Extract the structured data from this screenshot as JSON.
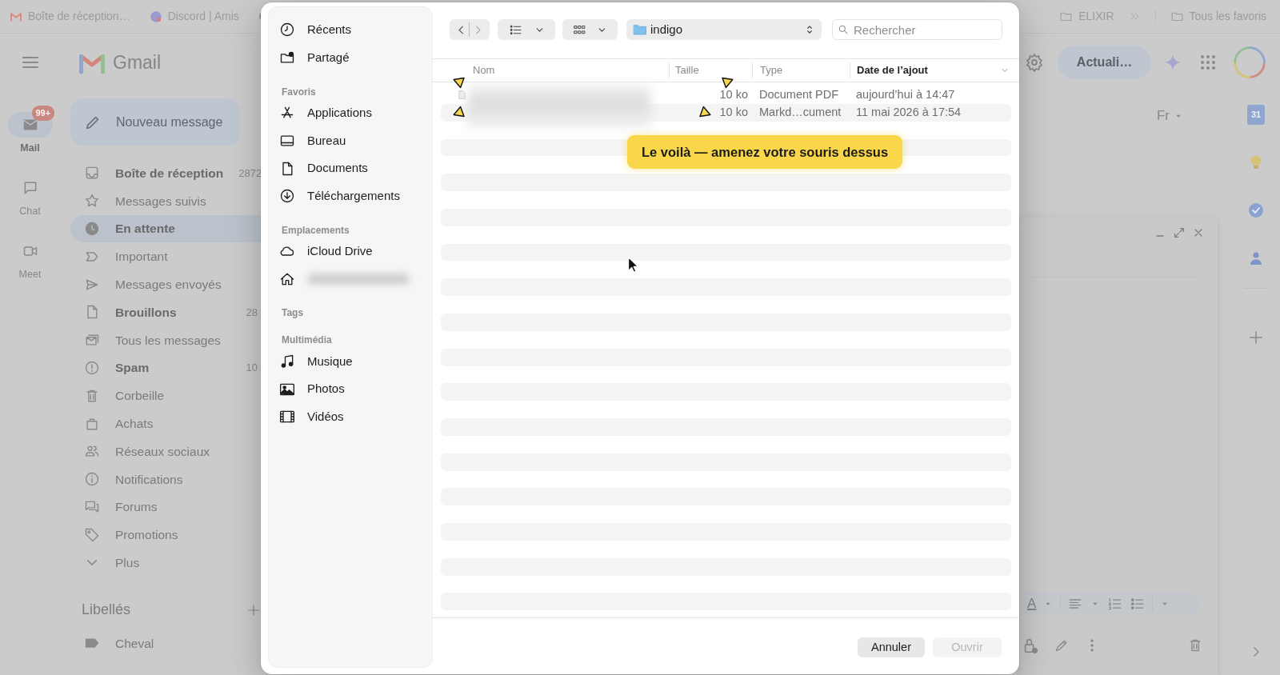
{
  "bookmarks_bar": {
    "left_items": [
      {
        "kind": "gmail",
        "label": "Boîte de réception…"
      },
      {
        "kind": "discord",
        "label": "Discord | Amis"
      },
      {
        "kind": "github"
      }
    ],
    "right_items": [
      {
        "kind": "folder",
        "label": "ELIXIR"
      },
      {
        "kind": "overflow"
      },
      {
        "kind": "folder",
        "label": "Tous les favoris"
      }
    ]
  },
  "gmail": {
    "app_name": "Gmail",
    "update_button": "Actuali…",
    "rail": [
      {
        "label": "Mail",
        "selected": true,
        "badge": "99+"
      },
      {
        "label": "Chat",
        "selected": false
      },
      {
        "label": "Meet",
        "selected": false
      }
    ],
    "compose_button": "Nouveau message",
    "nav": [
      {
        "label": "Boîte de réception",
        "count": "2872",
        "unread": true,
        "selected": false
      },
      {
        "label": "Messages suivis",
        "unread": false,
        "selected": false
      },
      {
        "label": "En attente",
        "unread": true,
        "selected": true
      },
      {
        "label": "Important",
        "unread": false,
        "selected": false
      },
      {
        "label": "Messages envoyés",
        "unread": false,
        "selected": false
      },
      {
        "label": "Brouillons",
        "count": "28",
        "unread": true,
        "selected": false
      },
      {
        "label": "Tous les messages",
        "unread": false,
        "selected": false
      },
      {
        "label": "Spam",
        "count": "10",
        "unread": true,
        "selected": false
      },
      {
        "label": "Corbeille",
        "unread": false,
        "selected": false
      },
      {
        "label": "Achats",
        "unread": false,
        "selected": false
      },
      {
        "label": "Réseaux sociaux",
        "unread": false,
        "selected": false
      },
      {
        "label": "Notifications",
        "unread": false,
        "selected": false
      },
      {
        "label": "Forums",
        "unread": false,
        "selected": false
      },
      {
        "label": "Promotions",
        "unread": false,
        "selected": false
      },
      {
        "label": "Plus",
        "unread": false,
        "selected": false
      }
    ],
    "labels_heading": "Libellés",
    "labels": [
      {
        "label": "Cheval"
      }
    ],
    "language_button": "Fr",
    "calendar_day": "31",
    "compose_window": {
      "format_letter": "A"
    }
  },
  "dialog": {
    "sidebar": [
      {
        "items": [
          {
            "label": "Récents"
          },
          {
            "label": "Partagé"
          }
        ]
      },
      {
        "heading": "Favoris",
        "items": [
          {
            "label": "Applications"
          },
          {
            "label": "Bureau"
          },
          {
            "label": "Documents"
          },
          {
            "label": "Téléchargements"
          }
        ]
      },
      {
        "heading": "Emplacements",
        "items": [
          {
            "label": "iCloud Drive"
          },
          {
            "blurred": true
          }
        ]
      },
      {
        "heading": "Tags"
      },
      {
        "heading": "Multimédia",
        "items": [
          {
            "label": "Musique"
          },
          {
            "label": "Photos"
          },
          {
            "label": "Vidéos"
          }
        ]
      }
    ],
    "location": "indigo",
    "search": {
      "placeholder": "Rechercher"
    },
    "columns": [
      {
        "label": "Nom",
        "sorted": false
      },
      {
        "label": "Taille",
        "sorted": false
      },
      {
        "label": "Type",
        "sorted": false
      },
      {
        "label": "Date de l’ajout",
        "sorted": true
      }
    ],
    "rows": [
      {
        "size": "10 ko",
        "type": "Document PDF",
        "date": "aujourd’hui à 14:47"
      },
      {
        "size": "10 ko",
        "type": "Markd…cument",
        "date": "11 mai 2026 à 17:54"
      }
    ],
    "buttons": [
      {
        "label": "Annuler",
        "disabled": false
      },
      {
        "label": "Ouvrir",
        "disabled": true
      }
    ]
  },
  "tooltip": {
    "text": "Le voilà — amenez votre souris dessus"
  }
}
